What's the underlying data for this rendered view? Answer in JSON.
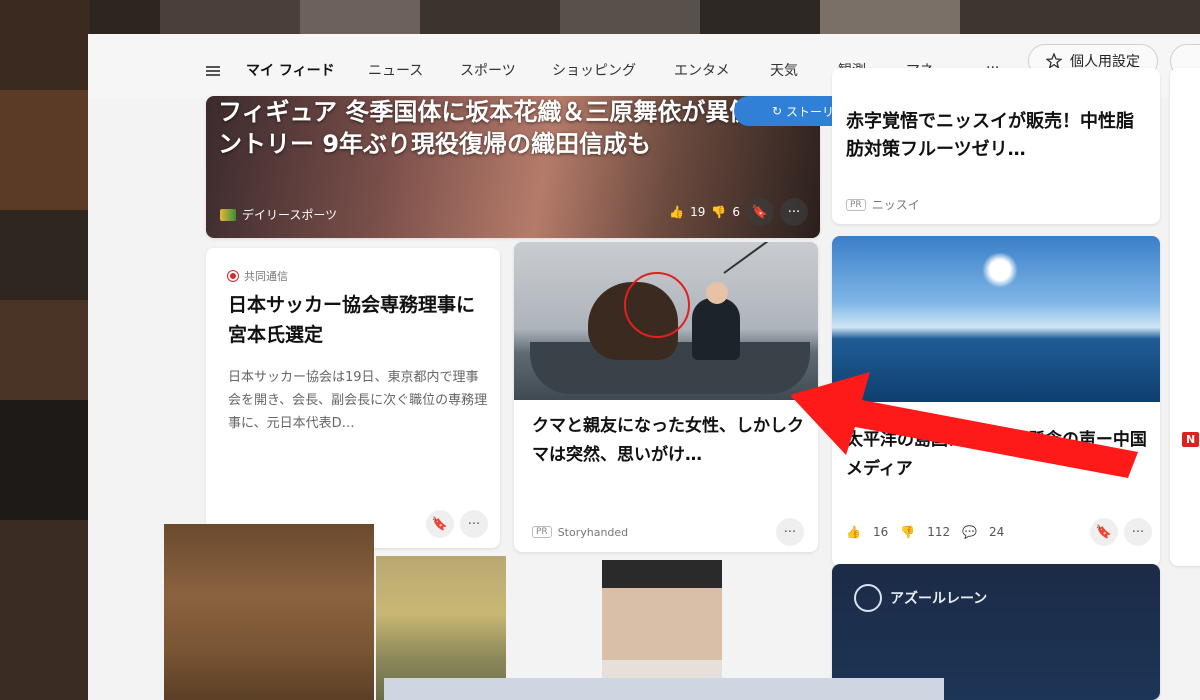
{
  "nav": {
    "items": [
      "マイ フィード",
      "ニュース",
      "スポーツ",
      "ショッピング",
      "エンタメ",
      "天気",
      "観測",
      "マネー"
    ],
    "more": "···",
    "settings_label": "個人用設定"
  },
  "update_pill": "ストーリーの更新",
  "hero": {
    "title": "フィギュア 冬季国体に坂本花織＆三原舞依が異例エントリー 9年ぶり現役復帰の織田信成も",
    "source": "デイリースポーツ",
    "likes": "19",
    "dislikes": "6"
  },
  "pr_card": {
    "title": "赤字覚悟でニッスイが販売！中性脂肪対策フルーツゼリ…",
    "pr_tag": "PR",
    "source": "ニッスイ"
  },
  "news1": {
    "source": "共同通信",
    "title": "日本サッカー協会専務理事に宮本氏選定",
    "body": "日本サッカー協会は19日、東京都内で理事会を開き、会長、副会長に次ぐ職位の専務理事に、元日本代表D…"
  },
  "news2": {
    "title": "クマと親友になった女性、しかしクマは突然、思いがけ…",
    "pr_tag": "PR",
    "source": "Storyhanded"
  },
  "news3": {
    "title": "太平洋の島国に7カ国を懸念の声ー中国メディア",
    "likes": "16",
    "dislikes": "112",
    "comments": "24"
  },
  "partial_card": {
    "badge": "N"
  },
  "bottom_card": {
    "game": "アズールレーン"
  },
  "colors": {
    "accent_blue": "#2f80d6",
    "arrow_red": "#ff1a1a",
    "marker_red": "#e02020"
  }
}
